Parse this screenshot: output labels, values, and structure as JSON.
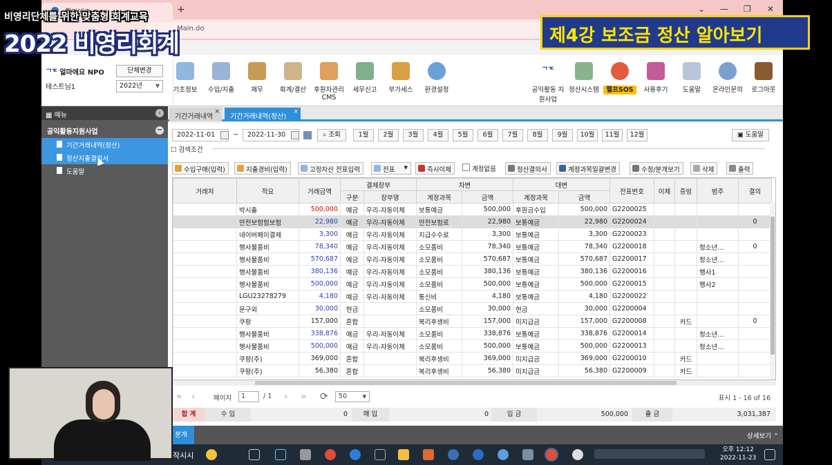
{
  "overlay": {
    "subtitle": "비영리단체를 위한 맞춤형 회계교육",
    "title": "2022 비영리회계",
    "lecture": "제4강 보조금 정산 알아보기"
  },
  "browser": {
    "tab_title": "얼마에요 4.0",
    "url": "Main.do"
  },
  "header": {
    "org_name": "얼마에요 NPO",
    "user": "테스트님1",
    "change_org": "단체변경",
    "year": "2022년",
    "menu": [
      "기초정보",
      "수입/지출",
      "재무",
      "회계/결산",
      "후원자관리 CMS",
      "세무신고",
      "부가세스",
      "환경설정"
    ],
    "right_menu": [
      "공익활동 지원사업",
      "정산시스템",
      "헬프SOS",
      "사용후기",
      "도움말",
      "온라인문의",
      "로그아웃"
    ]
  },
  "sidebar": {
    "title": "메뉴",
    "group": "공익활동지원사업",
    "items": [
      "기간거래내역(정산)",
      "정산지출결의서",
      "도움말"
    ]
  },
  "content_tabs": [
    "기간거래내역",
    "기간거래내역(정산)"
  ],
  "filters": {
    "start_date": "2022-11-01",
    "tilde": "~",
    "end_date": "2022-11-30",
    "search": "조회",
    "months": [
      "1월",
      "2월",
      "3월",
      "4월",
      "5월",
      "6월",
      "7월",
      "8월",
      "9월",
      "10월",
      "11월",
      "12월"
    ],
    "help": "도움말",
    "conditions": "검색조건"
  },
  "toolbar": [
    "수입구매(입력)",
    "지출경비(입력)",
    "고정자산 전표입력",
    "전표",
    "즉시이체",
    "계정없음",
    "정산결의서",
    "계정과목일괄변경",
    "수정/분개보기",
    "삭제",
    "출력"
  ],
  "grid": {
    "headers": {
      "counterparty": "거래처",
      "summary": "적요",
      "amount": "거래금액",
      "payment_ledger": "결제장부",
      "type": "구분",
      "book": "장부명",
      "debit": "차변",
      "debit_account": "계정과목",
      "debit_amount": "금액",
      "credit": "대변",
      "credit_account": "계정과목",
      "credit_amount": "금액",
      "slip_no": "전표번호",
      "transfer": "이체",
      "evidence": "증빙",
      "category": "범주",
      "approval": "결의"
    },
    "selected_row": 1,
    "rows": [
      {
        "counterparty": "",
        "summary": "박시출",
        "amount": "500,000",
        "amount_color": "red",
        "type": "예금",
        "book": "우리-자동이체",
        "debit_account": "보통예금",
        "debit_amount": "500,000",
        "credit_account": "후원금수입",
        "credit_amount": "500,000",
        "slip_no": "G2200025",
        "transfer": "",
        "evidence": "",
        "category": "",
        "approval": ""
      },
      {
        "counterparty": "",
        "summary": "안전보험험보험",
        "amount": "22,980",
        "amount_color": "blue",
        "type": "예금",
        "book": "우리-자동이체",
        "debit_account": "안전보험료",
        "debit_amount": "22,980",
        "credit_account": "보통예금",
        "credit_amount": "22,980",
        "slip_no": "G2200024",
        "transfer": "",
        "evidence": "",
        "category": "",
        "approval": "0"
      },
      {
        "counterparty": "",
        "summary": "네이버페이결제",
        "amount": "3,300",
        "amount_color": "blue",
        "type": "예금",
        "book": "우리-자동이체",
        "debit_account": "지급수수료",
        "debit_amount": "3,300",
        "credit_account": "보통예금",
        "credit_amount": "3,300",
        "slip_no": "G2200023",
        "transfer": "",
        "evidence": "",
        "category": "",
        "approval": ""
      },
      {
        "counterparty": "",
        "summary": "행사물품비",
        "amount": "78,340",
        "amount_color": "blue",
        "type": "예금",
        "book": "우리-자동이체",
        "debit_account": "소모품비",
        "debit_amount": "78,340",
        "credit_account": "보통예금",
        "credit_amount": "78,340",
        "slip_no": "G2200018",
        "transfer": "",
        "evidence": "",
        "category": "청소년…",
        "approval": "0"
      },
      {
        "counterparty": "",
        "summary": "행사물품비",
        "amount": "570,687",
        "amount_color": "blue",
        "type": "예금",
        "book": "우리-자동이체",
        "debit_account": "소모품비",
        "debit_amount": "570,687",
        "credit_account": "보통예금",
        "credit_amount": "570,687",
        "slip_no": "G2200017",
        "transfer": "",
        "evidence": "",
        "category": "청소년…",
        "approval": ""
      },
      {
        "counterparty": "",
        "summary": "행사물품비",
        "amount": "380,136",
        "amount_color": "blue",
        "type": "예금",
        "book": "우리-자동이체",
        "debit_account": "소모품비",
        "debit_amount": "380,136",
        "credit_account": "보통예금",
        "credit_amount": "380,136",
        "slip_no": "G2200016",
        "transfer": "",
        "evidence": "",
        "category": "행사1",
        "approval": ""
      },
      {
        "counterparty": "",
        "summary": "행사물품비",
        "amount": "500,000",
        "amount_color": "blue",
        "type": "예금",
        "book": "우리-자동이체",
        "debit_account": "소모품비",
        "debit_amount": "500,000",
        "credit_account": "보통예금",
        "credit_amount": "500,000",
        "slip_no": "G2200015",
        "transfer": "",
        "evidence": "",
        "category": "행사2",
        "approval": ""
      },
      {
        "counterparty": "",
        "summary": "LGU23278279",
        "amount": "4,180",
        "amount_color": "blue",
        "type": "예금",
        "book": "우리-자동이체",
        "debit_account": "통신비",
        "debit_amount": "4,180",
        "credit_account": "보통예금",
        "credit_amount": "4,180",
        "slip_no": "G2200022",
        "transfer": "",
        "evidence": "",
        "category": "",
        "approval": ""
      },
      {
        "counterparty": "",
        "summary": "문구외",
        "amount": "30,000",
        "amount_color": "blue",
        "type": "현금",
        "book": "",
        "debit_account": "소모품비",
        "debit_amount": "30,000",
        "credit_account": "현금",
        "credit_amount": "30,000",
        "slip_no": "G2200004",
        "transfer": "",
        "evidence": "",
        "category": "",
        "approval": ""
      },
      {
        "counterparty": "",
        "summary": "쿠팡",
        "amount": "157,000",
        "amount_color": "black",
        "type": "혼합",
        "book": "",
        "debit_account": "복리후생비",
        "debit_amount": "157,000",
        "credit_account": "미지급금",
        "credit_amount": "157,000",
        "slip_no": "G2200008",
        "transfer": "",
        "evidence": "카드",
        "category": "",
        "approval": "0"
      },
      {
        "counterparty": "",
        "summary": "행사물품비",
        "amount": "338,876",
        "amount_color": "blue",
        "type": "예금",
        "book": "우리-자동이체",
        "debit_account": "소모품비",
        "debit_amount": "338,876",
        "credit_account": "보통예금",
        "credit_amount": "338,876",
        "slip_no": "G2200014",
        "transfer": "",
        "evidence": "",
        "category": "청소년…",
        "approval": ""
      },
      {
        "counterparty": "",
        "summary": "행사물품비",
        "amount": "500,000",
        "amount_color": "blue",
        "type": "예금",
        "book": "우리-자동이체",
        "debit_account": "소모품비",
        "debit_amount": "500,000",
        "credit_account": "보통예금",
        "credit_amount": "500,000",
        "slip_no": "G2200013",
        "transfer": "",
        "evidence": "",
        "category": "청소년…",
        "approval": ""
      },
      {
        "counterparty": "",
        "summary": "쿠팡(주)",
        "amount": "369,000",
        "amount_color": "black",
        "type": "혼합",
        "book": "",
        "debit_account": "복리후생비",
        "debit_amount": "369,000",
        "credit_account": "미지급금",
        "credit_amount": "369,000",
        "slip_no": "G2200010",
        "transfer": "",
        "evidence": "카드",
        "category": "",
        "approval": ""
      },
      {
        "counterparty": "",
        "summary": "쿠팡(주)",
        "amount": "56,380",
        "amount_color": "black",
        "type": "혼합",
        "book": "",
        "debit_account": "복리후생비",
        "debit_amount": "56,380",
        "credit_account": "미지급금",
        "credit_amount": "56,380",
        "slip_no": "G2200009",
        "transfer": "",
        "evidence": "카드",
        "category": "",
        "approval": ""
      }
    ]
  },
  "pager": {
    "page_label": "페이지",
    "page": "1",
    "total_pages": "/ 1",
    "rows_per_page": "50",
    "summary": "표시 1 - 16 of 16"
  },
  "totals": {
    "total_label": "합 계",
    "income_label": "수 입",
    "income": "0",
    "sales_label": "매 입",
    "sales": "0",
    "deposit_label": "입 금",
    "deposit": "500,000",
    "withdrawal_label": "출 금",
    "withdrawal": "3,031,387"
  },
  "detail": {
    "left": "분개",
    "right": "상세보기"
  },
  "taskbar": {
    "label": "작시시",
    "time": "오후 12:12",
    "date": "2022-11-23"
  }
}
